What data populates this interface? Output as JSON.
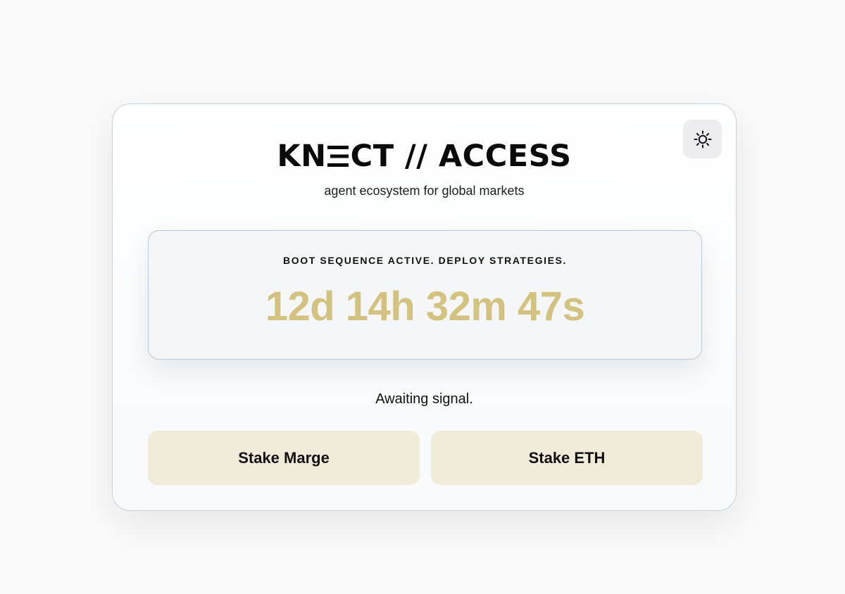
{
  "header": {
    "logo_left": "KN",
    "logo_right": "CT // ACCESS",
    "tagline": "agent ecosystem for global markets",
    "theme_icon": "sun-icon"
  },
  "countdown": {
    "label": "BOOT SEQUENCE ACTIVE. DEPLOY STRATEGIES.",
    "value": "12d 14h 32m 47s",
    "color": "#d4c281"
  },
  "status_text": "Awaiting signal.",
  "actions": {
    "stake_marge_label": "Stake Marge",
    "stake_eth_label": "Stake ETH",
    "button_color": "#f1ecda"
  }
}
